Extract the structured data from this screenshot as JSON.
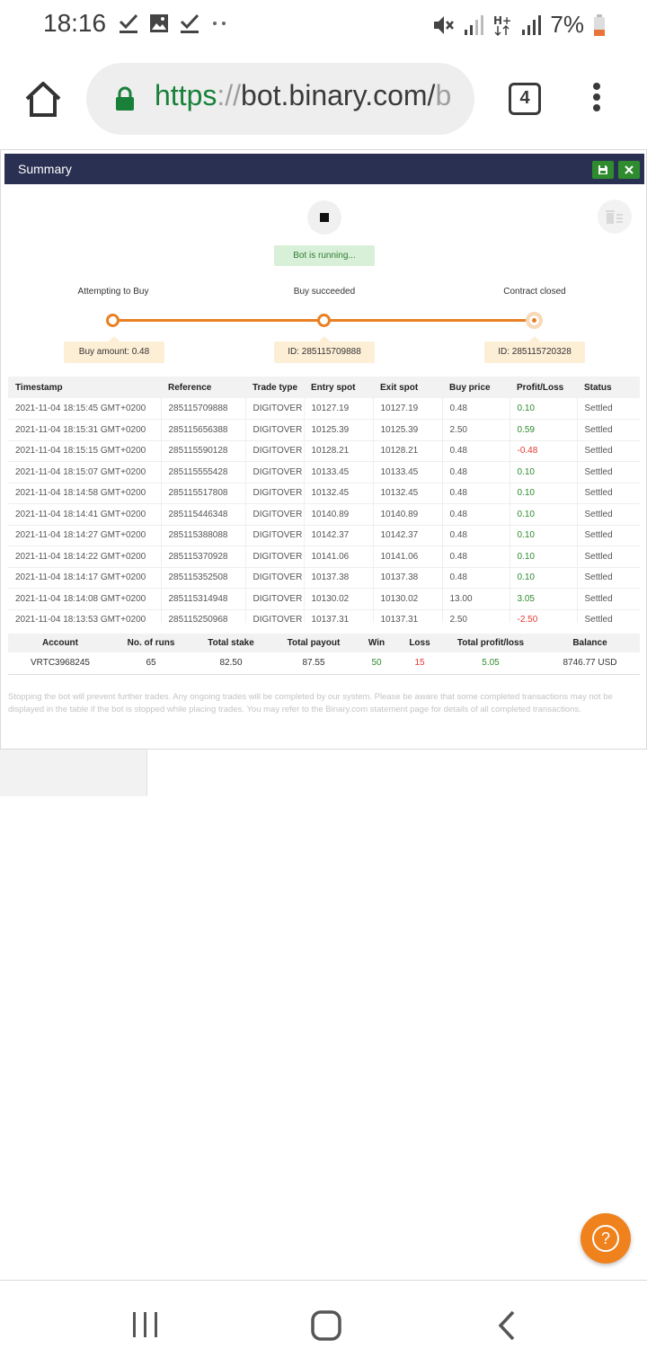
{
  "status_bar": {
    "time": "18:16",
    "battery_percent": "7%",
    "left_icons": [
      "check-icon",
      "image-icon",
      "check-icon",
      "more-dots-icon"
    ],
    "right_icons": [
      "mute-icon",
      "signal-icon",
      "hplus-icon",
      "signal-icon",
      "battery-low-icon"
    ]
  },
  "browser": {
    "url_scheme": "https",
    "url_sep": "://",
    "url_host": "bot.binary.com/",
    "url_trail": "b",
    "tab_count": "4"
  },
  "summary": {
    "title": "Summary",
    "running_status": "Bot is running...",
    "steps": [
      {
        "label": "Attempting to Buy",
        "detail": "Buy amount: 0.48"
      },
      {
        "label": "Buy succeeded",
        "detail": "ID: 285115709888"
      },
      {
        "label": "Contract closed",
        "detail": "ID: 285115720328"
      }
    ],
    "transactions": {
      "columns": [
        "Timestamp",
        "Reference",
        "Trade type",
        "Entry spot",
        "Exit spot",
        "Buy price",
        "Profit/Loss",
        "Status"
      ],
      "rows": [
        [
          "2021-11-04 18:15:45 GMT+0200",
          "285115709888",
          "DIGITOVER",
          "10127.19",
          "10127.19",
          "0.48",
          "0.10",
          "Settled"
        ],
        [
          "2021-11-04 18:15:31 GMT+0200",
          "285115656388",
          "DIGITOVER",
          "10125.39",
          "10125.39",
          "2.50",
          "0.59",
          "Settled"
        ],
        [
          "2021-11-04 18:15:15 GMT+0200",
          "285115590128",
          "DIGITOVER",
          "10128.21",
          "10128.21",
          "0.48",
          "-0.48",
          "Settled"
        ],
        [
          "2021-11-04 18:15:07 GMT+0200",
          "285115555428",
          "DIGITOVER",
          "10133.45",
          "10133.45",
          "0.48",
          "0.10",
          "Settled"
        ],
        [
          "2021-11-04 18:14:58 GMT+0200",
          "285115517808",
          "DIGITOVER",
          "10132.45",
          "10132.45",
          "0.48",
          "0.10",
          "Settled"
        ],
        [
          "2021-11-04 18:14:41 GMT+0200",
          "285115446348",
          "DIGITOVER",
          "10140.89",
          "10140.89",
          "0.48",
          "0.10",
          "Settled"
        ],
        [
          "2021-11-04 18:14:27 GMT+0200",
          "285115388088",
          "DIGITOVER",
          "10142.37",
          "10142.37",
          "0.48",
          "0.10",
          "Settled"
        ],
        [
          "2021-11-04 18:14:22 GMT+0200",
          "285115370928",
          "DIGITOVER",
          "10141.06",
          "10141.06",
          "0.48",
          "0.10",
          "Settled"
        ],
        [
          "2021-11-04 18:14:17 GMT+0200",
          "285115352508",
          "DIGITOVER",
          "10137.38",
          "10137.38",
          "0.48",
          "0.10",
          "Settled"
        ],
        [
          "2021-11-04 18:14:08 GMT+0200",
          "285115314948",
          "DIGITOVER",
          "10130.02",
          "10130.02",
          "13.00",
          "3.05",
          "Settled"
        ],
        [
          "2021-11-04 18:13:53 GMT+0200",
          "285115250968",
          "DIGITOVER",
          "10137.31",
          "10137.31",
          "2.50",
          "-2.50",
          "Settled"
        ]
      ]
    },
    "stats": {
      "columns": [
        "Account",
        "No. of runs",
        "Total stake",
        "Total payout",
        "Win",
        "Loss",
        "Total profit/loss",
        "Balance"
      ],
      "values": [
        "VRTC3968245",
        "65",
        "82.50",
        "87.55",
        "50",
        "15",
        "5.05",
        "8746.77 USD"
      ]
    },
    "disclaimer": "Stopping the bot will prevent further trades. Any ongoing trades will be completed by our system. Please be aware that some completed transactions may not be displayed in the table if the bot is stopped while placing trades. You may refer to the Binary.com statement page for details of all completed transactions."
  },
  "colors": {
    "header_bg": "#2a3052",
    "accent_orange": "#e98024",
    "profit_green": "#2e8b2e",
    "loss_red": "#e53935",
    "url_green": "#188038"
  }
}
